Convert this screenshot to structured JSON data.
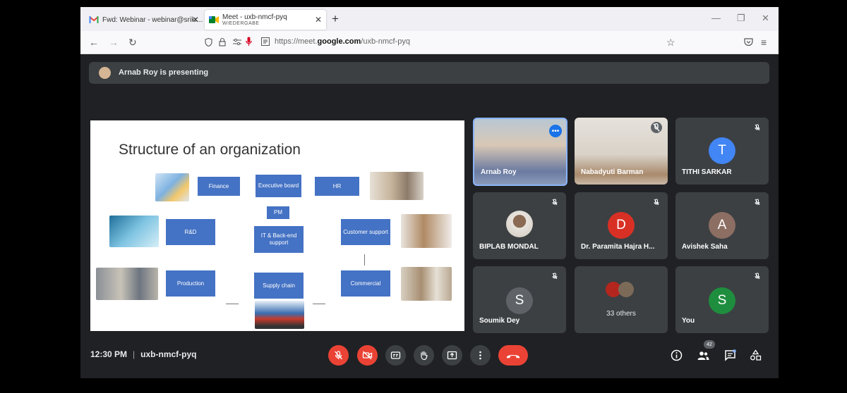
{
  "browser": {
    "tabs": [
      {
        "label": "Fwd: Webinar - webinar@srikr..."
      },
      {
        "label": "Meet - uxb-nmcf-pyq",
        "sublabel": "WIEDERGABE"
      }
    ],
    "url_prefix": "https://meet.",
    "url_domain": "google.com",
    "url_path": "/uxb-nmcf-pyq"
  },
  "meet": {
    "presenting_text": "Arnab Roy is presenting",
    "slide": {
      "title": "Structure of an organization",
      "boxes": {
        "finance": "Finance",
        "executive": "Executive board",
        "hr": "HR",
        "pm": "PM",
        "rd": "R&D",
        "it": "IT & Back-end support",
        "customer": "Customer support",
        "production": "Production",
        "supply": "Supply chain",
        "commercial": "Commercial"
      }
    },
    "participants": [
      {
        "name": "Arnab Roy",
        "type": "video"
      },
      {
        "name": "Nabadyuti Barman",
        "type": "video"
      },
      {
        "name": "TITHI SARKAR",
        "initial": "T",
        "color": "#4285f4"
      },
      {
        "name": "BIPLAB MONDAL",
        "type": "photo"
      },
      {
        "name": "Dr. Paramita Hajra H...",
        "initial": "D",
        "color": "#d93025"
      },
      {
        "name": "Avishek Saha",
        "initial": "A",
        "color": "#8d6e63"
      },
      {
        "name": "Soumik Dey",
        "initial": "S",
        "color": "#5f6368"
      },
      {
        "name": "33 others",
        "type": "group"
      },
      {
        "name": "You",
        "initial": "S",
        "color": "#1e8e3e"
      }
    ],
    "time": "12:30 PM",
    "meeting_code": "uxb-nmcf-pyq",
    "people_count": "42"
  },
  "colors": {
    "end_call": "#ea4335",
    "tile_bg": "#3c4043",
    "slide_box": "#4472c4"
  }
}
